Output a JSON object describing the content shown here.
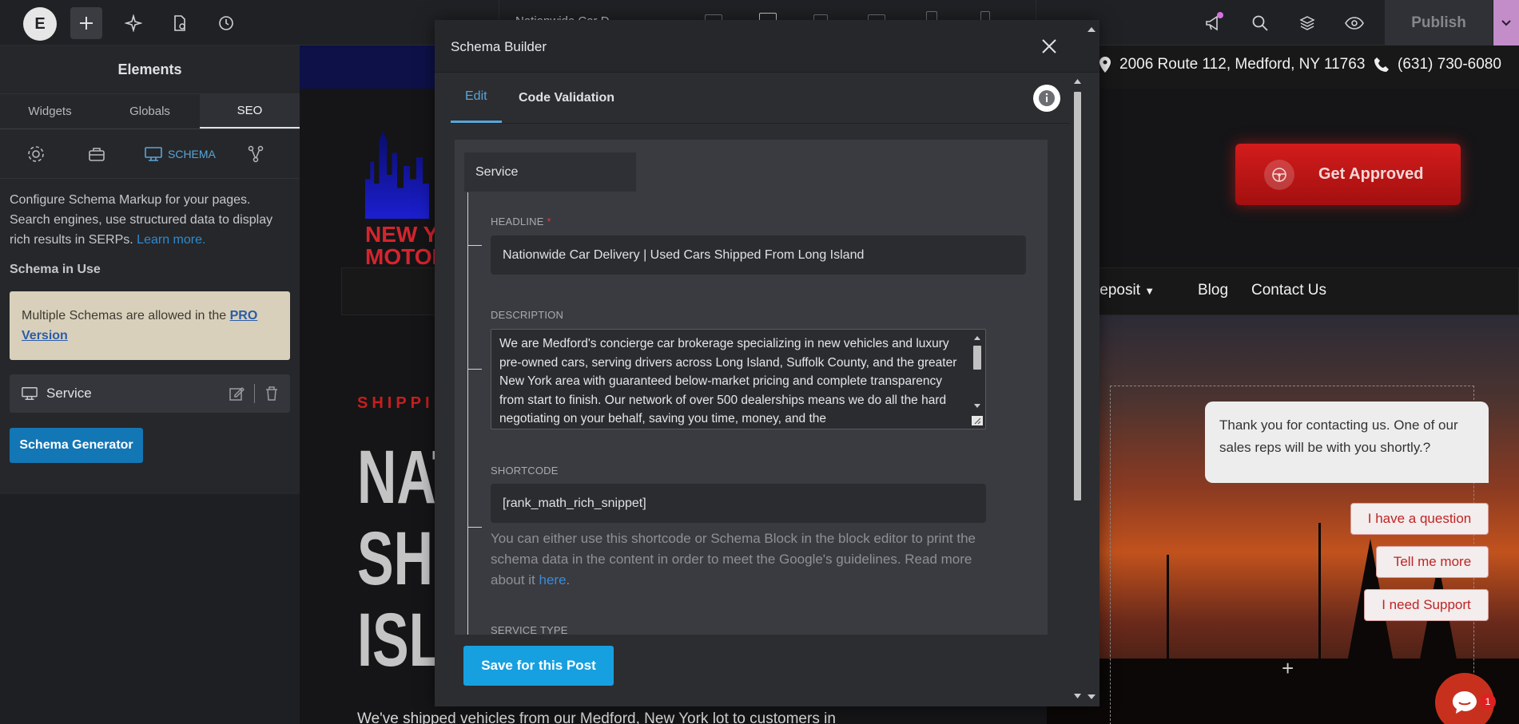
{
  "topbar": {
    "logo_letter": "E",
    "doc_title": "Nationwide Car D",
    "publish_label": "Publish"
  },
  "panel": {
    "title": "Elements",
    "tabs": [
      {
        "label": "Widgets"
      },
      {
        "label": "Globals"
      },
      {
        "label": "SEO"
      }
    ],
    "schema_label": "SCHEMA",
    "description": "Configure Schema Markup for your pages. Search engines, use structured data to display rich results in SERPs.",
    "learn_more": "Learn more.",
    "schema_in_use": "Schema in Use",
    "pro_text": "Multiple Schemas are allowed in the",
    "pro_link": "PRO Version",
    "service_label": "Service",
    "generator_label": "Schema Generator"
  },
  "site": {
    "address": "2006 Route 112, Medford, NY 11763",
    "phone": "(631) 730-6080",
    "logo_line1": "NEW Y",
    "logo_line2": "MOTOR",
    "cta_label": "Get Approved",
    "nav": [
      "t/Deposit",
      "Blog",
      "Contact Us"
    ],
    "shipping_label": "SHIPPIN",
    "headline_lines": [
      "NAT",
      "SHI",
      "ISL"
    ],
    "body_snip": "We've shipped vehicles from our Medford, New York lot to customers in"
  },
  "chat": {
    "message": "Thank you for contacting us. One of our sales reps will be with you shortly.?",
    "options": [
      "I have a question",
      "Tell me more",
      "I need Support"
    ],
    "badge_count": "1"
  },
  "modal": {
    "title": "Schema Builder",
    "tabs": [
      {
        "label": "Edit"
      },
      {
        "label": "Code Validation"
      }
    ],
    "schema_type": "Service",
    "headline_label": "HEADLINE",
    "headline_required": "*",
    "headline_value": "Nationwide Car Delivery | Used Cars Shipped From Long Island",
    "description_label": "DESCRIPTION",
    "description_value": "We are Medford's concierge car brokerage specializing in new vehicles and luxury pre-owned cars, serving drivers across Long Island, Suffolk County, and the greater New York area with guaranteed below-market pricing and complete transparency from start to finish. Our network of over 500 dealerships means we do all the hard negotiating on your behalf, saving you time, money, and the",
    "shortcode_label": "SHORTCODE",
    "shortcode_value": "[rank_math_rich_snippet]",
    "help_text": "You can either use this shortcode or Schema Block in the block editor to print the schema data in the content in order to meet the Google's guidelines. Read more about it",
    "help_link": "here",
    "help_end": ".",
    "service_type_label": "SERVICE TYPE",
    "save_label": "Save for this Post"
  },
  "colors": {
    "accent": "#58a6d7",
    "save_button": "#17a0e0",
    "generator_button": "#1376b5",
    "cta_red": "#c81e1e"
  }
}
